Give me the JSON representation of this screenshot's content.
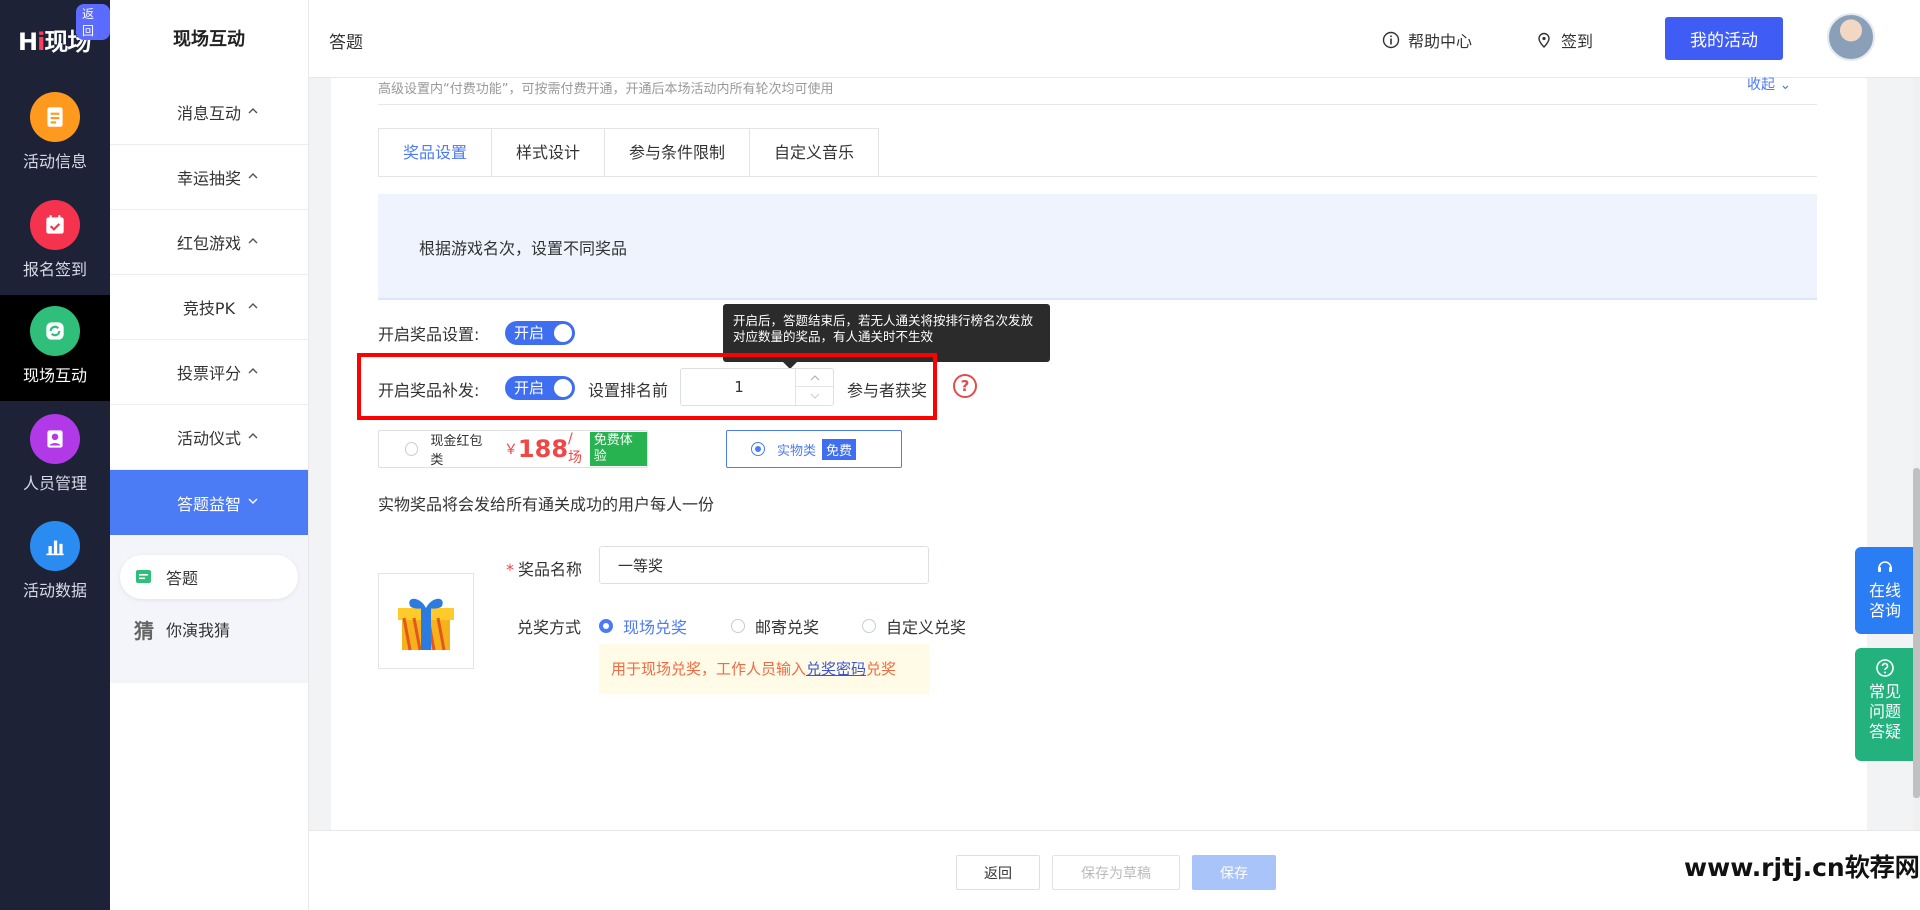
{
  "brand": {
    "logo_text": "现场",
    "logo_hi": "H",
    "logo_i": "i",
    "back_badge": "返回"
  },
  "leftnav": [
    {
      "label": "活动信息",
      "icon": "document-icon",
      "color": "#ff9a1f"
    },
    {
      "label": "报名签到",
      "icon": "calendar-check-icon",
      "color": "#f5334f"
    },
    {
      "label": "现场互动",
      "icon": "interaction-icon",
      "color": "#2fbf7a",
      "active": true
    },
    {
      "label": "人员管理",
      "icon": "user-card-icon",
      "color": "#b239e8"
    },
    {
      "label": "活动数据",
      "icon": "bar-chart-icon",
      "color": "#2a8cf0"
    }
  ],
  "sidebar": {
    "title": "现场互动",
    "items": [
      "消息互动",
      "幸运抽奖",
      "红包游戏",
      "竞技PK",
      "投票评分",
      "活动仪式",
      "答题益智"
    ],
    "active": "答题益智",
    "subitems": [
      "答题",
      "你演我猜"
    ],
    "guess_glyph": "猜"
  },
  "header": {
    "page_title": "答题",
    "help": "帮助中心",
    "signin": "签到",
    "my_activity": "我的活动"
  },
  "main": {
    "note": "高级设置内“付费功能”，可按需付费开通，开通后本场活动内所有轮次均可使用",
    "collapse": "收起",
    "tabs": [
      "奖品设置",
      "样式设计",
      "参与条件限制",
      "自定义音乐"
    ],
    "info_text": "根据游戏名次，设置不同奖品",
    "prize_setting_label": "开启奖品设置:",
    "switch_on": "开启",
    "reissue_label": "开启奖品补发:",
    "rank_prefix": "设置排名前",
    "rank_value": "1",
    "rank_suffix": "参与者获奖",
    "tooltip": "开启后，答题结束后，若无人通关将按排行榜名次发放对应数量的奖品，有人通关时不生效",
    "qmark": "?",
    "cash_option": {
      "label": "现金红包类",
      "currency": "￥",
      "price": "188",
      "unit": "/场",
      "tag": "免费体验"
    },
    "physical_option": {
      "label": "实物类",
      "tag": "免费"
    },
    "physical_note": "实物奖品将会发给所有通关成功的用户每人一份",
    "prize_name_label": "奖品名称",
    "prize_name_required": "*",
    "prize_name_value": "一等奖",
    "redeem_label": "兑奖方式",
    "redeem_options": [
      "现场兑奖",
      "邮寄兑奖",
      "自定义兑奖"
    ],
    "redeem_selected": "现场兑奖",
    "redeem_hint_pre": "用于现场兑奖，工作人员输入",
    "redeem_hint_link": "兑奖密码",
    "redeem_hint_post": "兑奖"
  },
  "footer": {
    "back": "返回",
    "draft": "保存为草稿",
    "save": "保存"
  },
  "float": {
    "consult": "在线咨询",
    "faq": "常见问题答疑"
  },
  "watermark": "www.rjtj.cn软荐网"
}
